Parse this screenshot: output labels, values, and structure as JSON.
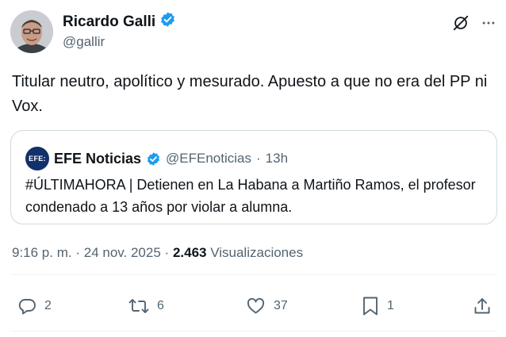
{
  "author": {
    "name": "Ricardo Galli",
    "handle": "@gallir",
    "verified": true
  },
  "tweet_text": "Titular neutro, apolítico y mesurado. Apuesto a que no era del PP ni Vox.",
  "quoted": {
    "logo_text": "EFE:",
    "name": "EFE Noticias",
    "handle": "@EFEnoticias",
    "separator": "·",
    "time": "13h",
    "text": "#ÚLTIMAHORA | Detienen en La Habana a Martiño Ramos, el profesor condenado a 13 años por violar a alumna."
  },
  "meta": {
    "time": "9:16 p. m.",
    "sep1": "·",
    "date": "24 nov. 2025",
    "sep2": "·",
    "views_count": "2.463",
    "views_label": "Visualizaciones"
  },
  "actions": {
    "replies": "2",
    "reposts": "6",
    "likes": "37",
    "bookmarks": "1"
  },
  "icons": [
    "grok-icon",
    "more-icon",
    "reply-icon",
    "repost-icon",
    "like-icon",
    "bookmark-icon",
    "share-icon",
    "verified-badge-icon"
  ],
  "colors": {
    "verified": "#1d9bf0",
    "secondary_text": "#536471",
    "primary_text": "#0f1419",
    "border": "#cfd9de"
  }
}
